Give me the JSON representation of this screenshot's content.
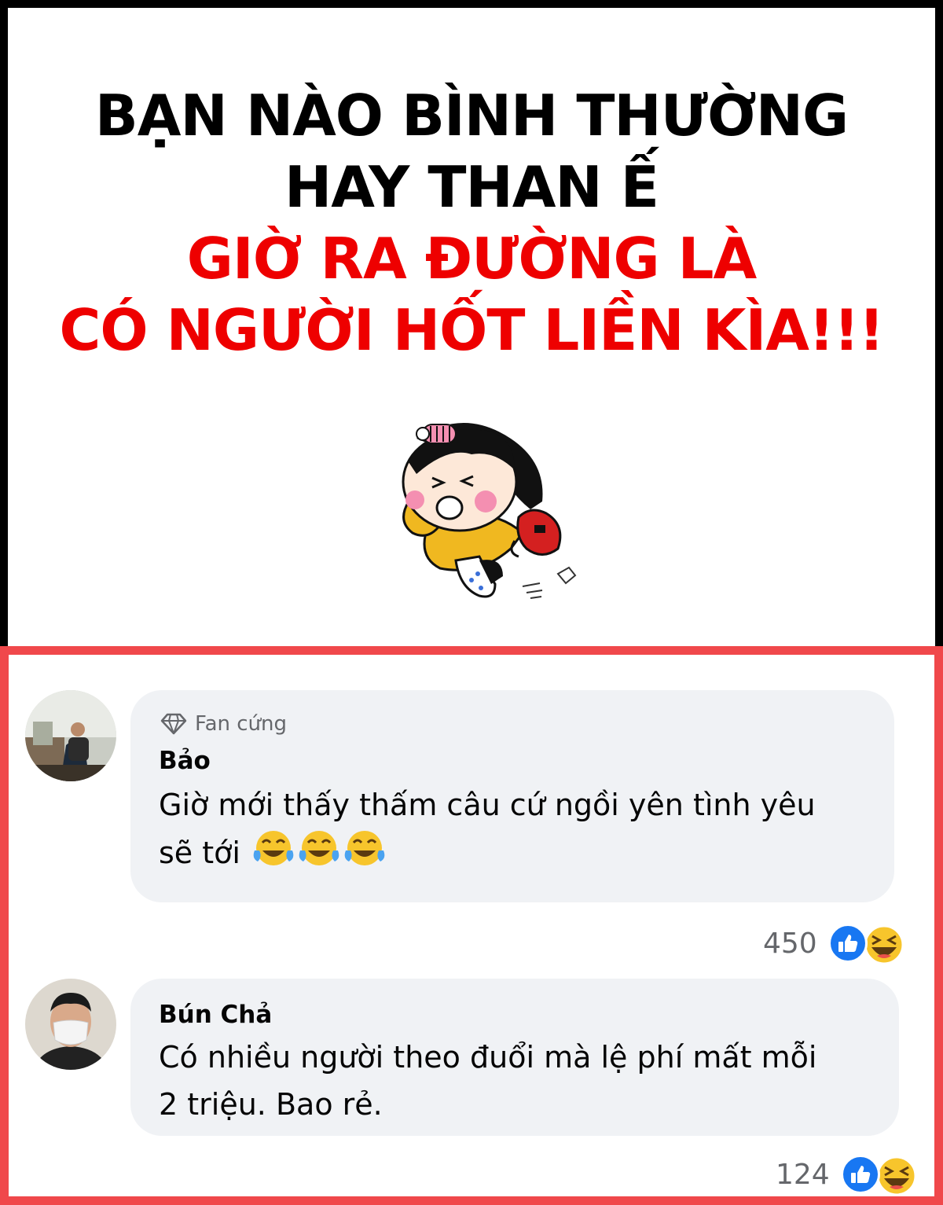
{
  "headline": {
    "line1": "BẠN NÀO BÌNH THƯỜNG",
    "line2": "HAY THAN Ế",
    "line3": "GIỜ RA ĐƯỜNG LÀ",
    "line4": "CÓ NGƯỜI HỐT LIỀN KÌA!!!"
  },
  "colors": {
    "headline_black": "#000000",
    "headline_red": "#ee0000",
    "panel_border": "#f0484b",
    "bubble_bg": "#f0f2f5",
    "like_blue": "#1877f2"
  },
  "sticker": {
    "icon": "running-girl-with-purse-sticker"
  },
  "comments": [
    {
      "badge_label": "Fan cứng",
      "badge_icon": "diamond-icon",
      "author": "Bảo",
      "text_line1": "Giờ mới thấy thấm câu cứ ngồi yên tình yêu",
      "text_line2": "sẽ tới",
      "emojis": [
        "tears-of-joy-emoji",
        "tears-of-joy-emoji",
        "tears-of-joy-emoji"
      ],
      "reaction_count": "450",
      "reactions": [
        "like-icon",
        "haha-icon"
      ]
    },
    {
      "author": "Bún Chả",
      "text_line1": "Có nhiều người theo đuổi mà lệ phí mất mỗi",
      "text_line2": "2 triệu. Bao rẻ.",
      "reaction_count": "124",
      "reactions": [
        "like-icon",
        "haha-icon"
      ]
    }
  ]
}
